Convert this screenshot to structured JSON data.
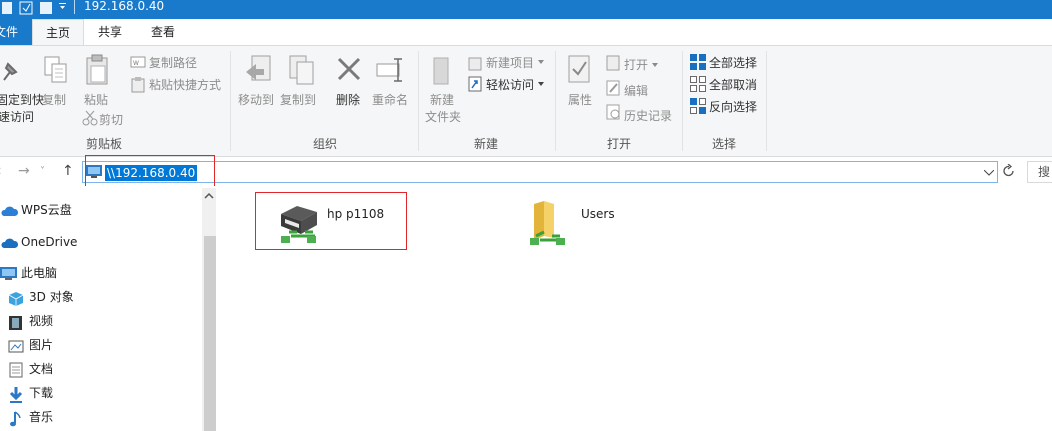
{
  "window": {
    "title": "192.168.0.40"
  },
  "tabs": {
    "file": "文件",
    "home": "主页",
    "share": "共享",
    "view": "查看"
  },
  "ribbon": {
    "clipboard": {
      "pin_line1": "固定到快",
      "pin_line2": "速访问",
      "copy": "复制",
      "paste": "粘贴",
      "copy_path": "复制路径",
      "paste_shortcut": "粘贴快捷方式",
      "cut": "剪切",
      "label": "剪贴板"
    },
    "organize": {
      "move_to": "移动到",
      "copy_to": "复制到",
      "delete": "删除",
      "rename": "重命名",
      "label": "组织"
    },
    "new": {
      "new_folder_line1": "新建",
      "new_folder_line2": "文件夹",
      "new_item": "新建项目",
      "easy_access": "轻松访问",
      "label": "新建"
    },
    "open": {
      "properties": "属性",
      "open": "打开",
      "edit": "编辑",
      "history": "历史记录",
      "label": "打开"
    },
    "select": {
      "select_all": "全部选择",
      "select_none": "全部取消",
      "invert": "反向选择",
      "label": "选择"
    }
  },
  "address": {
    "path": "\\\\192.168.0.40",
    "search_placeholder": "搜"
  },
  "nav": {
    "items": [
      {
        "label": "WPS云盘",
        "icon": "cloud-icon"
      },
      {
        "label": "OneDrive",
        "icon": "onedrive-icon"
      },
      {
        "label": "此电脑",
        "icon": "computer-icon"
      },
      {
        "label": "3D 对象",
        "icon": "cube-3d-icon"
      },
      {
        "label": "视频",
        "icon": "video-icon"
      },
      {
        "label": "图片",
        "icon": "pictures-icon"
      },
      {
        "label": "文档",
        "icon": "documents-icon"
      },
      {
        "label": "下载",
        "icon": "download-icon"
      },
      {
        "label": "音乐",
        "icon": "music-icon"
      }
    ]
  },
  "content": {
    "items": [
      {
        "label": "hp  p1108",
        "icon": "network-printer-icon"
      },
      {
        "label": "Users",
        "icon": "shared-folder-icon"
      }
    ]
  },
  "colors": {
    "accent": "#1979ca",
    "selection": "#0078d7",
    "highlight_box": "#e0262b"
  }
}
